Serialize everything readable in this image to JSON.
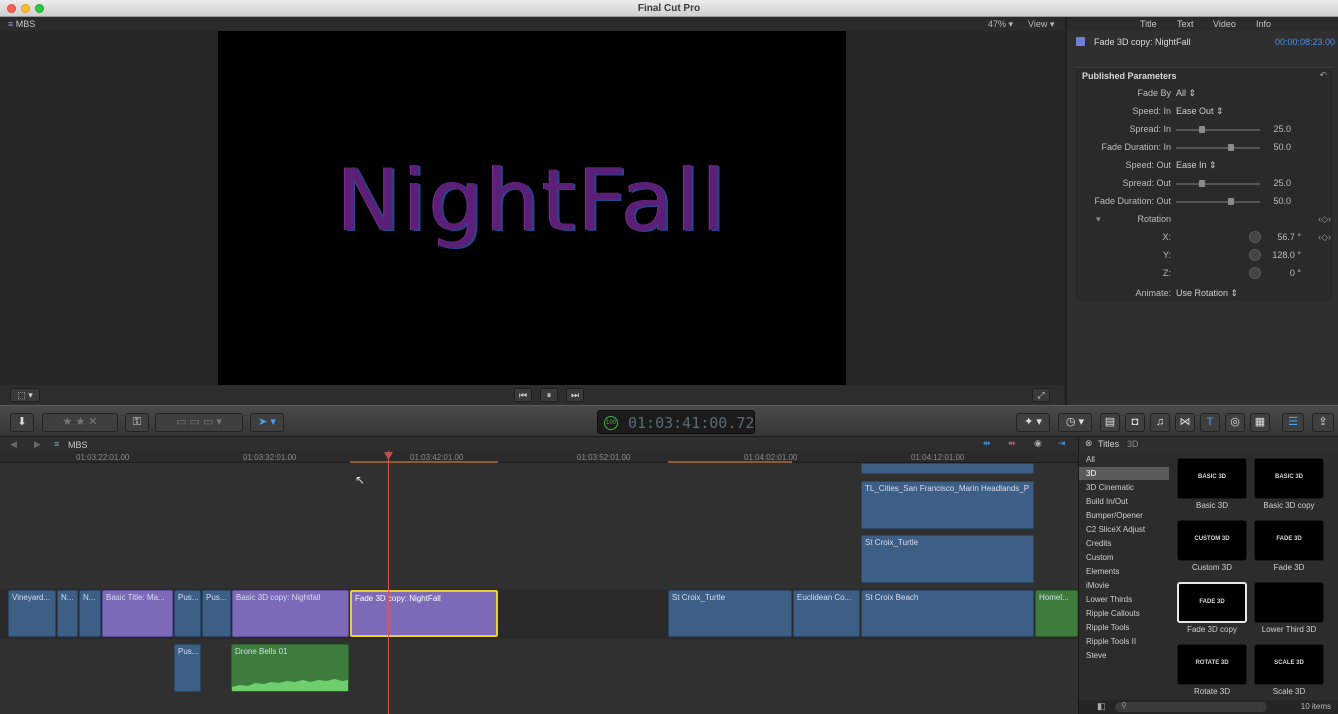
{
  "window": {
    "title": "Final Cut Pro"
  },
  "viewer": {
    "project": "MBS",
    "zoom": "47%",
    "view_label": "View",
    "canvas_text": "NightFall"
  },
  "inspector": {
    "tabs": [
      "Title",
      "Text",
      "Video",
      "Info"
    ],
    "clip_name": "Fade 3D copy: NightFall",
    "duration": "00:00:08:23.00",
    "section": "Published Parameters",
    "params": [
      {
        "label": "Fade By",
        "value": "All"
      },
      {
        "label": "Speed: In",
        "value": "Ease Out"
      },
      {
        "label": "Spread: In",
        "number": "25.0",
        "slider": 0.27
      },
      {
        "label": "Fade Duration: In",
        "number": "50.0",
        "slider": 0.62
      },
      {
        "label": "Speed: Out",
        "value": "Ease In"
      },
      {
        "label": "Spread: Out",
        "number": "25.0",
        "slider": 0.27
      },
      {
        "label": "Fade Duration: Out",
        "number": "50.0",
        "slider": 0.62
      },
      {
        "label": "Rotation"
      },
      {
        "label": "X:",
        "number": "56.7 °"
      },
      {
        "label": "Y:",
        "number": "128.0 °"
      },
      {
        "label": "Z:",
        "number": "0 °"
      },
      {
        "label": "Animate:",
        "value": "Use Rotation"
      }
    ]
  },
  "toolbar": {
    "timecode": "01:03:41:00.72",
    "timecode_badge": "100"
  },
  "timeline": {
    "project": "MBS",
    "ruler": [
      "01:03:22:01.00",
      "01:03:32:01.00",
      "01:03:42:01.00",
      "01:03:52:01.00",
      "01:04:02:01.00",
      "01:04:12:01.00"
    ],
    "clips": {
      "c1": "Vineyard...",
      "c2": "N...",
      "c3": "N...",
      "c4": "Basic Title: Ma...",
      "c5": "Pus...",
      "c6": "Pus...",
      "c7": "Basic 3D copy: Nightfall",
      "c8": "Fade 3D copy: NightFall",
      "c9": "St Croix_Turtle",
      "c10": "Euclidean Co...",
      "c11": "St Croix Beach",
      "c12": "Homel...",
      "c13": "TL_Cities_San Francisco_Marin Headlands_P",
      "c14": "St Croix_Turtle",
      "c15": "Pus...",
      "c16": "Drone Bells 01"
    }
  },
  "browser": {
    "title": "Titles",
    "subtitle": "3D",
    "categories": [
      "All",
      "3D",
      "3D Cinematic",
      "Build In/Out",
      "Bumper/Opener",
      "C2 SliceX Adjust",
      "Credits",
      "Custom",
      "Elements",
      "iMovie",
      "Lower Thirds",
      "Ripple Callouts",
      "Ripple Tools",
      "Ripple Tools II",
      "Steve"
    ],
    "items": [
      {
        "thumb": "BASIC 3D",
        "name": "Basic 3D"
      },
      {
        "thumb": "BASIC 3D",
        "name": "Basic 3D copy"
      },
      {
        "thumb": "CUSTOM 3D",
        "name": "Custom 3D"
      },
      {
        "thumb": "FADE 3D",
        "name": "Fade 3D"
      },
      {
        "thumb": "FADE 3D",
        "name": "Fade 3D copy"
      },
      {
        "thumb": "",
        "name": "Lower Third 3D"
      },
      {
        "thumb": "ROTATE 3D",
        "name": "Rotate 3D"
      },
      {
        "thumb": "SCALE 3D",
        "name": "Scale 3D"
      }
    ],
    "count": "10 items"
  }
}
